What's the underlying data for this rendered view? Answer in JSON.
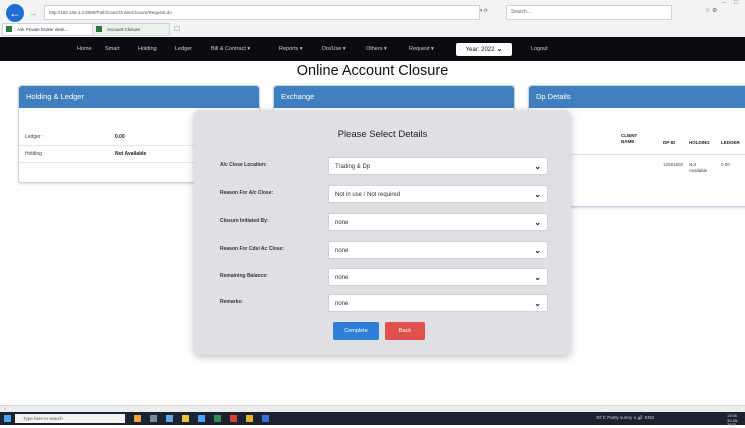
{
  "browser": {
    "url": "http://192.168.4.2:8080/Path/Cans/OnlineClosure/Request.do",
    "address_controls": "▾ ⟳",
    "search_placeholder": "Search...",
    "right_icons": "☆ ⚙",
    "tabs": [
      {
        "label": "Ask Private broker desk..."
      },
      {
        "label": "Account Closure"
      }
    ]
  },
  "nav": {
    "items": [
      "Home",
      "Smart",
      "Holding",
      "Ledger",
      "Bill & Contract ▾",
      "Reports ▾",
      "Dis/Use ▾",
      "Others ▾",
      "Request ▾"
    ],
    "year_label": "Year: 2022",
    "logout": "Logout"
  },
  "page_title": "Online Account Closure",
  "panels": {
    "holding_ledger": {
      "title": "Holding & Ledger",
      "rows": [
        {
          "key": "Ledger :",
          "value": "0.00"
        },
        {
          "key": "Holding",
          "value": "Not Available"
        }
      ]
    },
    "exchange": {
      "title": "Exchange"
    },
    "dp_details": {
      "title": "Dp Details",
      "columns": [
        "CLIENT NAME",
        "DP-ID",
        "HOLDING",
        "LEDGER"
      ],
      "row": {
        "client_name": "",
        "dp_id": "12081600",
        "holding": "Not Available",
        "ledger": "0.00"
      }
    }
  },
  "modal": {
    "title": "Please Select Details",
    "fields": [
      {
        "label": "A/c Close Location:",
        "value": "Trading & Dp"
      },
      {
        "label": "Reason For A/c Close:",
        "value": "Not in use / Not required"
      },
      {
        "label": "Closure Initiated By:",
        "value": "none"
      },
      {
        "label": "Reason For Cdsl Ac Close:",
        "value": "none"
      },
      {
        "label": "Remaining Balance:",
        "value": "none"
      },
      {
        "label": "Remarks:",
        "value": "none"
      }
    ],
    "complete_label": "Complete",
    "back_label": "Back"
  },
  "taskbar": {
    "search_placeholder": "Type here to search",
    "tray_text": "30°C Partly sunny  ∧  🔊  ENG",
    "time": "13:06",
    "date": "30-05-2022"
  },
  "colors": {
    "panel_header": "#3f7fbf",
    "complete_button": "#2f7fd8",
    "back_button": "#e0504c",
    "navbar": "#0c0c10"
  }
}
